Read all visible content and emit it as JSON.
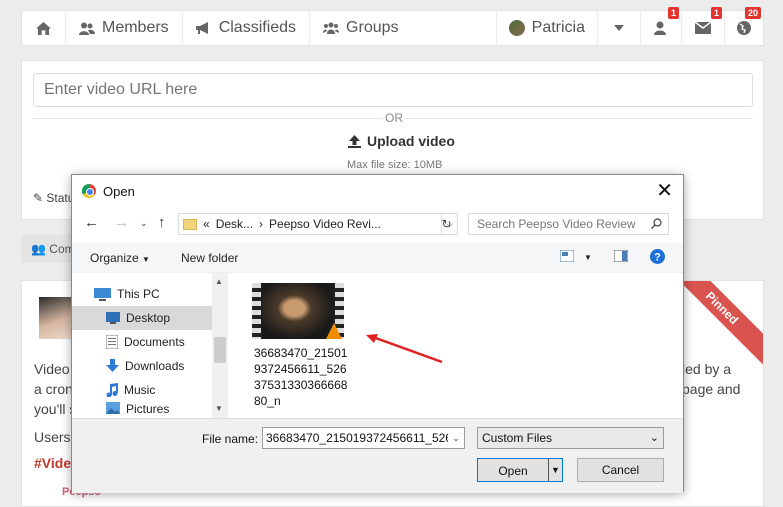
{
  "topnav": {
    "members": "Members",
    "classifieds": "Classifieds",
    "groups": "Groups",
    "user": "Patricia",
    "friend_badge": "1",
    "message_badge": "1",
    "notif_badge": "20"
  },
  "postbox": {
    "url_placeholder": "Enter video URL here",
    "or": "OR",
    "upload": "Upload video",
    "max_size": "Max file size: 10MB",
    "status_tab": "Statu"
  },
  "filter": {
    "label": "Com"
  },
  "post": {
    "text_lines": [
      "Video",
      "a cron jo",
      "you'll s"
    ],
    "right_lines": [
      "led by a",
      "page and"
    ],
    "users_line": "Users",
    "hashtag": "#Video",
    "pinned": "Pinned",
    "footer": "Peepso"
  },
  "dialog": {
    "title": "Open",
    "address": {
      "prefix": "«",
      "seg1": "Desk...",
      "seg2": "Peepso Video Revi..."
    },
    "search_placeholder": "Search Peepso Video Review",
    "toolbar": {
      "organize": "Organize",
      "new_folder": "New folder"
    },
    "sidebar": [
      "This PC",
      "Desktop",
      "Documents",
      "Downloads",
      "Music",
      "Pictures"
    ],
    "file": {
      "name": "36683470_215019372456611_5263753133036666880_n"
    },
    "file_name_label": "File name:",
    "file_name_value": "36683470_215019372456611_52637",
    "filter_value": "Custom Files",
    "open_label": "Open",
    "cancel_label": "Cancel"
  },
  "colors": {
    "accent_red": "#e3342f",
    "pinned": "#d9534f",
    "dialog_focus": "#0078d7"
  }
}
